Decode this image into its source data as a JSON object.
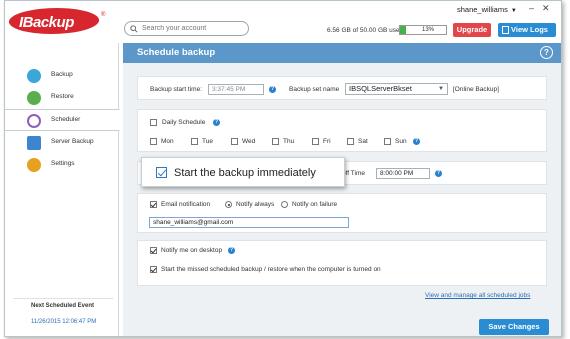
{
  "app": {
    "logo_text": "IBackup",
    "logo_reg": "®"
  },
  "header": {
    "search_placeholder": "Search your account",
    "user": "shane_williams",
    "storage_text": "6.56 GB of 50.00 GB used",
    "storage_percent_label": "13%",
    "storage_percent": 13,
    "upgrade_label": "Upgrade",
    "view_logs_label": "View Logs"
  },
  "sidebar": {
    "items": [
      {
        "label": "Backup",
        "icon": "cloud-upload-icon",
        "color": "#3aa7d9"
      },
      {
        "label": "Restore",
        "icon": "cloud-download-icon",
        "color": "#5aae4d"
      },
      {
        "label": "Scheduler",
        "icon": "clock-icon",
        "color": "#8d5fb8"
      },
      {
        "label": "Server Backup",
        "icon": "server-icon",
        "color": "#3c86cf"
      },
      {
        "label": "Settings",
        "icon": "gear-icon",
        "color": "#e6a21f"
      }
    ],
    "next_event_label": "Next Scheduled Event",
    "next_event_date": "11/26/2015 12:06:47 PM"
  },
  "main": {
    "title": "Schedule backup",
    "help": "?",
    "backup_start_time_label": "Backup start time:",
    "backup_start_time_value": "3:37:45 PM",
    "backup_set_label": "Backup set name",
    "backup_set_value": "IBSQLServerBkset",
    "backup_set_type": "[Online Backup]",
    "daily_schedule_label": "Daily Schedule",
    "days": [
      "Mon",
      "Tue",
      "Wed",
      "Thu",
      "Fri",
      "Sat",
      "Sun"
    ],
    "cutoff_label": "off Time",
    "cutoff_value": "8:00:00 PM",
    "tooltip_text": "Start the backup immediately",
    "email_notification_label": "Email notification",
    "notify_always_label": "Notify always",
    "notify_failure_label": "Notify on failure",
    "email_value": "shane_williams@gmail.com",
    "notify_desktop_label": "Notify me on desktop",
    "missed_schedule_label": "Start the missed scheduled backup / restore when the computer is turned on",
    "view_manage_link": "View and manage all scheduled jobs",
    "save_label": "Save Changes"
  }
}
